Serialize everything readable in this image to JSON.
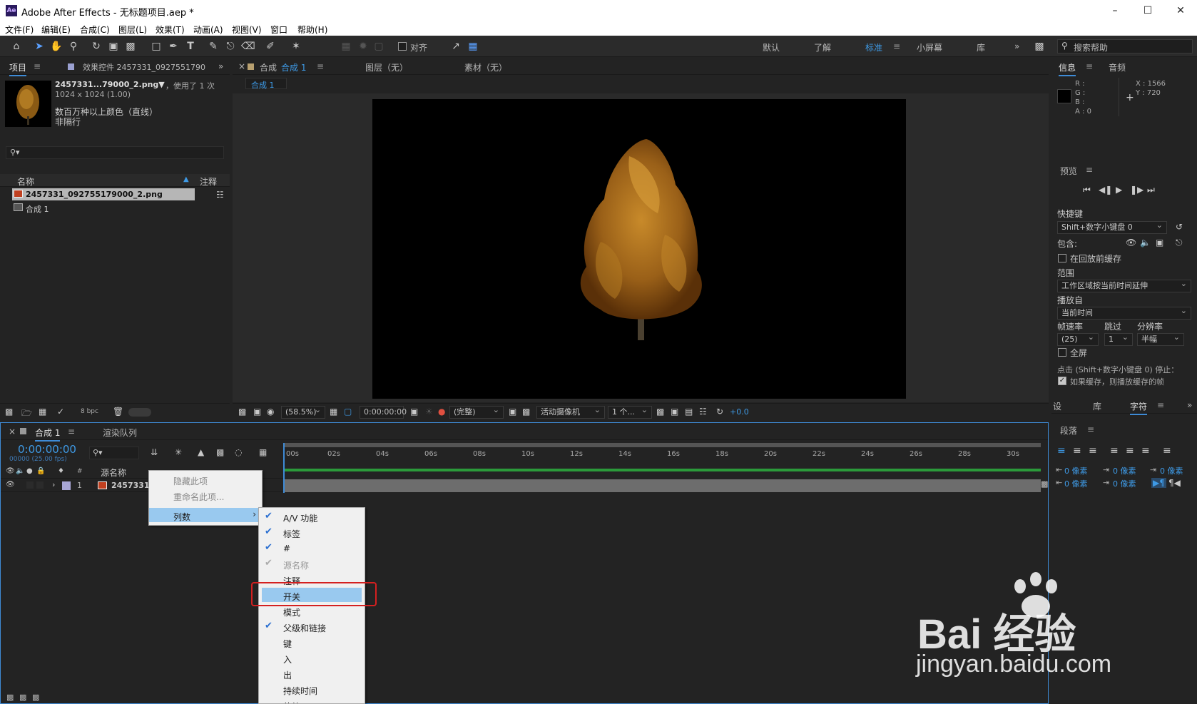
{
  "window": {
    "title": "Adobe After Effects - 无标题项目.aep *",
    "app_icon": "Ae"
  },
  "menu": [
    "文件(F)",
    "编辑(E)",
    "合成(C)",
    "图层(L)",
    "效果(T)",
    "动画(A)",
    "视图(V)",
    "窗口",
    "帮助(H)"
  ],
  "toolbar": {
    "align_label": "对齐",
    "workspaces": [
      "默认",
      "了解",
      "标准",
      "小屏幕",
      "库"
    ],
    "active_workspace": "标准",
    "search_placeholder": "搜索帮助"
  },
  "project": {
    "tab_project": "项目",
    "tab_effects": "效果控件 2457331_0927551790",
    "item_name": "2457331...79000_2.png▼",
    "item_used": "，使用了 1 次",
    "item_dims": "1024 x 1024 (1.00)",
    "item_color": "数百万种以上颜色（直线）",
    "item_interlace": "非隔行",
    "col_name": "名称",
    "col_comment": "注释",
    "rows": [
      "2457331_092755179000_2.png",
      "合成 1"
    ],
    "bpc": "8 bpc"
  },
  "viewer": {
    "tab_comp": "合成",
    "tab_comp_name": "合成 1",
    "tab_layer": "图层（无）",
    "tab_footage": "素材（无）",
    "sub_tab": "合成 1",
    "zoom": "(58.5%)",
    "time": "0:00:00:00",
    "quality": "(完整)",
    "camera": "活动摄像机",
    "views": "1 个...",
    "exposure": "+0.0"
  },
  "info": {
    "tab_info": "信息",
    "tab_audio": "音频",
    "r": "R :",
    "g": "G :",
    "b": "B :",
    "a": "A : 0",
    "x": "X : 1566",
    "y": "Y : 720"
  },
  "preview": {
    "title": "预览",
    "shortcut_label": "快捷键",
    "shortcut_value": "Shift+数字小键盘 0",
    "include_label": "包含:",
    "cache_label": "在回放前缓存",
    "range_label": "范围",
    "range_value": "工作区域按当前时间延伸",
    "playfrom_label": "播放自",
    "playfrom_value": "当前时间",
    "fps_label": "帧速率",
    "skip_label": "跳过",
    "res_label": "分辨率",
    "fps_value": "(25)",
    "skip_value": "1",
    "res_value": "半幅",
    "fullscreen_label": "全屏",
    "stop_text": "点击 (Shift+数字小键盘 0) 停止：",
    "cache_stop_text": "如果缓存，则播放缓存的帧"
  },
  "right_tabs": {
    "t1": "设",
    "t2": "库",
    "t3": "字符"
  },
  "paragraph": {
    "title": "段落",
    "indent_vals": [
      "0 像素",
      "0 像素",
      "0 像素",
      "0 像素",
      "0 像素"
    ]
  },
  "timeline": {
    "tab_comp": "合成 1",
    "tab_render": "渲染队列",
    "timecode": "0:00:00:00",
    "timecode_sub": "00000 (25.00 fps)",
    "col_source": "源名称",
    "col_num": "#",
    "layer_num": "1",
    "layer_name": "2457331",
    "ruler": [
      "00s",
      "02s",
      "04s",
      "06s",
      "08s",
      "10s",
      "12s",
      "14s",
      "16s",
      "18s",
      "20s",
      "22s",
      "24s",
      "26s",
      "28s",
      "30s"
    ]
  },
  "context_menu": {
    "items": [
      "隐藏此项",
      "重命名此项...",
      "列数"
    ]
  },
  "columns_submenu": {
    "items": [
      {
        "label": "A/V 功能",
        "checked": true
      },
      {
        "label": "标签",
        "checked": true
      },
      {
        "label": "#",
        "checked": true
      },
      {
        "label": "源名称",
        "checked": true,
        "disabled": true
      },
      {
        "label": "注释",
        "checked": false
      },
      {
        "label": "开关",
        "checked": false,
        "highlighted": true
      },
      {
        "label": "模式",
        "checked": false
      },
      {
        "label": "父级和链接",
        "checked": true
      },
      {
        "label": "键",
        "checked": false
      },
      {
        "label": "入",
        "checked": false
      },
      {
        "label": "出",
        "checked": false
      },
      {
        "label": "持续时间",
        "checked": false
      },
      {
        "label": "伸缩",
        "checked": false
      }
    ]
  },
  "watermark": {
    "brand": "Bai 经验",
    "url": "jingyan.baidu.com"
  }
}
